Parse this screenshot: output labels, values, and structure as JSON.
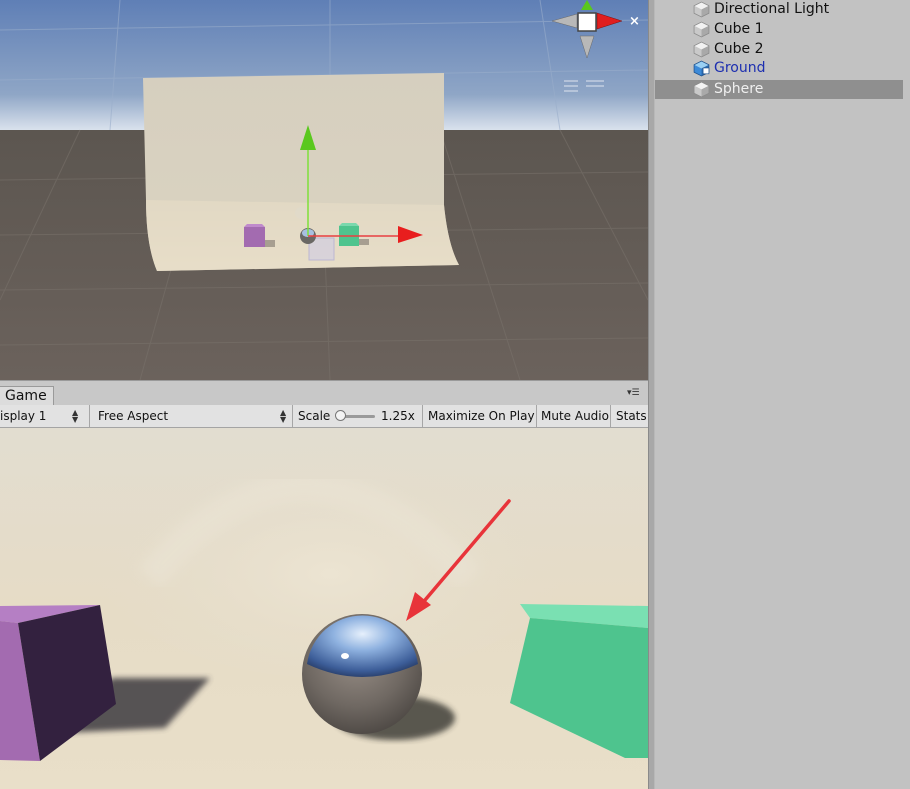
{
  "hierarchy": {
    "items": [
      {
        "label": "Directional Light",
        "selected": false,
        "prefab": false
      },
      {
        "label": "Cube 1",
        "selected": false,
        "prefab": false
      },
      {
        "label": "Cube 2",
        "selected": false,
        "prefab": false
      },
      {
        "label": "Ground",
        "selected": false,
        "prefab": true
      },
      {
        "label": "Sphere",
        "selected": true,
        "prefab": false
      }
    ]
  },
  "game": {
    "tab_label": "Game",
    "display_label": "isplay 1",
    "aspect_label": "Free Aspect",
    "scale_label": "Scale",
    "scale_value": "1.25x",
    "maximize_label": "Maximize On Play",
    "mute_label": "Mute Audio",
    "stats_label": "Stats"
  },
  "colors": {
    "cube1": "#a36bb0",
    "cube2": "#4ec48e",
    "arrow_annotation": "#e8343a",
    "selected_row": "#8f8f8f",
    "prefab_text": "#1d2fb0"
  },
  "icons": {
    "scene_gizmo": "orientation-gizmo-icon",
    "hierarchy_item": "gameobject-cube-icon",
    "scene_menu": "scene-menu-icon"
  }
}
